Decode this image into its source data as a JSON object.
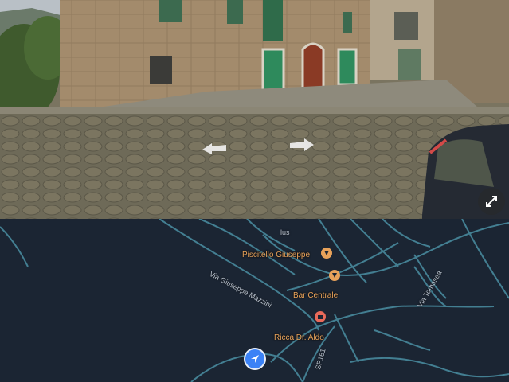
{
  "street_view": {
    "nav_arrows": [
      "left-arrow-icon",
      "right-arrow-icon"
    ],
    "expand_icon": "expand-icon"
  },
  "map": {
    "places": [
      {
        "name": "Piscitello Giuseppe",
        "icon": "food-pin-icon"
      },
      {
        "name": "Bar Centrale",
        "icon": "cafe-pin-icon"
      },
      {
        "name": "Ricca Dr. Aldo",
        "icon": "shopping-pin-icon"
      }
    ],
    "roads": {
      "mazzini": "Via Giuseppe Mazzini",
      "tomasea": "Via Tomasea",
      "sp": "SP161",
      "top": "lus"
    },
    "colors": {
      "map_bg": "#1b2533",
      "road": "#4a8fa3",
      "poi": "#e8a25a",
      "location": "#3b82f6"
    }
  }
}
